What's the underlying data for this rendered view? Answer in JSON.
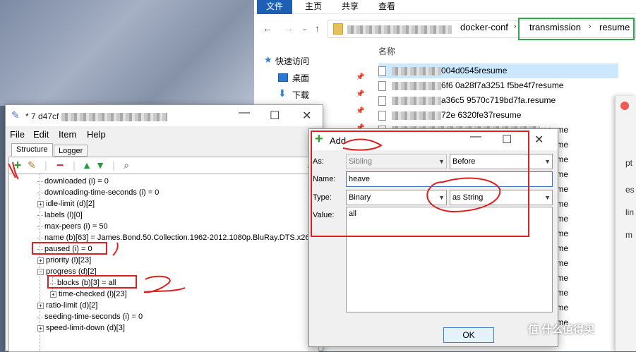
{
  "explorer": {
    "ribbon_tabs": [
      "文件",
      "主页",
      "共享",
      "查看"
    ],
    "breadcrumb": [
      "docker-conf",
      "transmission",
      "resume"
    ],
    "nav_items": [
      "快速访问",
      "桌面",
      "下载"
    ],
    "column_header": "名称",
    "files": [
      {
        "suffix": "004d0545",
        "ext": "resume"
      },
      {
        "suffix": "6f6   0a28f7a3251   f5be4f7",
        "ext": "resume"
      },
      {
        "suffix": "a36c5      9570c719bd7fa.",
        "ext": "resume"
      },
      {
        "suffix": "72e   6320fe37",
        "ext": "resume"
      },
      {
        "suffix": "",
        "ext": "resume"
      },
      {
        "suffix": "",
        "ext": "resume"
      },
      {
        "suffix": "",
        "ext": "resume"
      },
      {
        "suffix": "",
        "ext": "resume"
      },
      {
        "suffix": "",
        "ext": "resume"
      },
      {
        "suffix": "",
        "ext": "resume"
      },
      {
        "suffix": "",
        "ext": "resume"
      },
      {
        "suffix": "",
        "ext": "resume"
      },
      {
        "suffix": "",
        "ext": "resume"
      },
      {
        "suffix": "",
        "ext": "resume"
      },
      {
        "suffix": "",
        "ext": "resume"
      },
      {
        "suffix": "",
        "ext": "resume"
      },
      {
        "suffix": "",
        "ext": "resume"
      },
      {
        "suffix": "",
        "ext": "resume"
      }
    ]
  },
  "side_panel": {
    "letters": [
      "pt",
      "es",
      "lin",
      "m"
    ]
  },
  "editor": {
    "title": "* 7 d47cf",
    "menu": [
      "File",
      "Edit",
      "Item",
      "Help"
    ],
    "tabs": [
      "Structure",
      "Logger"
    ],
    "tree": [
      {
        "label": "downloaded (i) = 0",
        "expandable": false
      },
      {
        "label": "downloading-time-seconds (i) = 0",
        "expandable": false
      },
      {
        "label": "idle-limit (d)[2]",
        "expandable": true
      },
      {
        "label": "labels (l)[0]",
        "expandable": false
      },
      {
        "label": "max-peers (i) = 50",
        "expandable": false
      },
      {
        "label": "name (b)[63] = James.Bond.50.Collection.1962-2012.1080p.BluRay.DTS.x26",
        "expandable": false
      },
      {
        "label": "paused (i) = 0",
        "expandable": false
      },
      {
        "label": "priority (l)[23]",
        "expandable": true
      },
      {
        "label": "progress (d)[2]",
        "expandable": true,
        "expanded": true
      },
      {
        "label": "blocks (b)[3] = all",
        "expandable": false,
        "child": true
      },
      {
        "label": "time-checked (l)[23]",
        "expandable": true,
        "child": true
      },
      {
        "label": "ratio-limit (d)[2]",
        "expandable": true
      },
      {
        "label": "seeding-time-seconds (i) = 0",
        "expandable": false
      },
      {
        "label": "speed-limit-down (d)[3]",
        "expandable": true
      }
    ]
  },
  "add_dialog": {
    "title": "Add",
    "as_label": "As:",
    "as_value": "Sibling",
    "position_value": "Before",
    "name_label": "Name:",
    "name_value": "heave",
    "type_label": "Type:",
    "type_value": "Binary",
    "format_value": "as String",
    "value_label": "Value:",
    "value_text": "all",
    "ok_label": "OK"
  },
  "watermark": "值 什么值得买",
  "colors": {
    "annotation_red": "#e02020",
    "annotation_green": "#2ca84a",
    "ribbon_file_blue": "#1e5fb4"
  }
}
